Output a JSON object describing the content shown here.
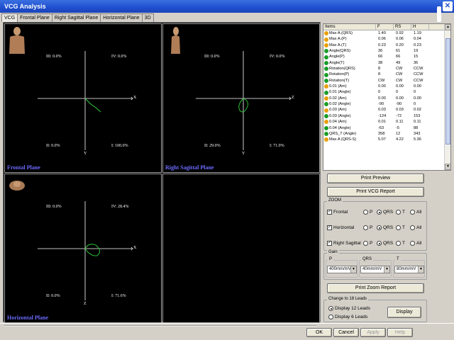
{
  "window": {
    "title": "VCG Analysis"
  },
  "tabs": [
    {
      "label": "VCG",
      "active": true
    },
    {
      "label": "Frontal Plane",
      "active": false
    },
    {
      "label": "Right Sagittal Plane",
      "active": false
    },
    {
      "label": "Horizontal Plane",
      "active": false
    },
    {
      "label": "3D",
      "active": false
    }
  ],
  "planes": {
    "frontal": {
      "label": "Frontal Plane",
      "q_top_left": "III: 0.0%",
      "q_top_right": "IV: 0.0%",
      "q_bottom_left": "II: 0.0%",
      "q_bottom_right": "I: 100.0%",
      "axis_x": "X",
      "axis_y": "Y"
    },
    "sagittal": {
      "label": "Right Sagittal Plane",
      "q_top_left": "III: 0.0%",
      "q_top_right": "IV: 0.0%",
      "q_bottom_left": "II: 29.0%",
      "q_bottom_right": "I: 71.0%",
      "axis_x": "Z",
      "axis_y": "Y"
    },
    "horizontal": {
      "label": "Horizontal Plane",
      "q_top_left": "III: 0.0%",
      "q_top_right": "IV: 28.4%",
      "q_bottom_left": "II: 0.0%",
      "q_bottom_right": "I: 71.6%",
      "axis_x": "X",
      "axis_y": "Z"
    }
  },
  "table": {
    "columns": [
      "Items",
      "F",
      "RS",
      "H"
    ],
    "rows": [
      {
        "icon": "yellow",
        "item": "Max A.(QRS)",
        "f": "1.40",
        "rs": "0.92",
        "h": "1.19"
      },
      {
        "icon": "yellow",
        "item": "Max A.(P)",
        "f": "0.06",
        "rs": "0.06",
        "h": "0.04"
      },
      {
        "icon": "yellow",
        "item": "Max A.(T)",
        "f": "0.23",
        "rs": "0.20",
        "h": "0.23"
      },
      {
        "icon": "green",
        "item": "Angle(QRS)",
        "f": "36",
        "rs": "61",
        "h": "19"
      },
      {
        "icon": "green",
        "item": "Angle(P)",
        "f": "66",
        "rs": "66",
        "h": "15"
      },
      {
        "icon": "green",
        "item": "Angle(T)",
        "f": "38",
        "rs": "49",
        "h": "36"
      },
      {
        "icon": "green",
        "item": "Rotation(QRS)",
        "f": "8",
        "rs": "CW",
        "h": "CCW"
      },
      {
        "icon": "green",
        "item": "Rotation(P)",
        "f": "8",
        "rs": "CW",
        "h": "CCW"
      },
      {
        "icon": "green",
        "item": "Rotation(T)",
        "f": "CW",
        "rs": "CW",
        "h": "CCW"
      },
      {
        "icon": "yellow",
        "item": "0.01 (Am)",
        "f": "0.00",
        "rs": "0.00",
        "h": "0.00"
      },
      {
        "icon": "green",
        "item": "0.01 (Angle)",
        "f": "0",
        "rs": "0",
        "h": "0"
      },
      {
        "icon": "yellow",
        "item": "0.02 (Am)",
        "f": "0.00",
        "rs": "0.00",
        "h": "0.00"
      },
      {
        "icon": "green",
        "item": "0.02 (Angle)",
        "f": "-90",
        "rs": "-90",
        "h": "0"
      },
      {
        "icon": "yellow",
        "item": "0.03 (Am)",
        "f": "0.03",
        "rs": "0.03",
        "h": "0.02"
      },
      {
        "icon": "green",
        "item": "0.03 (Angle)",
        "f": "-124",
        "rs": "-72",
        "h": "153"
      },
      {
        "icon": "yellow",
        "item": "0.04 (Am)",
        "f": "0.01",
        "rs": "0.11",
        "h": "0.11"
      },
      {
        "icon": "green",
        "item": "0.04 (Angle)",
        "f": "-63",
        "rs": "-5",
        "h": "88"
      },
      {
        "icon": "green",
        "item": "QRS_T (Angle)",
        "f": "358",
        "rs": "12",
        "h": "343"
      },
      {
        "icon": "yellow",
        "item": "Max A (QRS-S)",
        "f": "5.07",
        "rs": "4.22",
        "h": "5.36"
      }
    ]
  },
  "buttons": {
    "print_preview": "Print Preview",
    "print_vcg_report": "Print VCG Report",
    "print_zoom_report": "Print Zoom Report",
    "display": "Display",
    "ok": "OK",
    "cancel": "Cancel",
    "apply": "Apply",
    "help": "Help"
  },
  "zoom": {
    "title": "ZOOM",
    "rows": [
      {
        "label": "Frontal",
        "checked": true,
        "selected": "QRS"
      },
      {
        "label": "Horizontal",
        "checked": true,
        "selected": "QRS"
      },
      {
        "label": "Right Sagittal",
        "checked": true,
        "selected": "QRS"
      }
    ],
    "options": [
      "P",
      "QRS",
      "T",
      "All"
    ]
  },
  "gain": {
    "title": "Gain",
    "p_label": "P",
    "qrs_label": "QRS",
    "t_label": "T",
    "p_value": "400mm/mV",
    "qrs_value": "40mm/mV",
    "t_value": "80mm/mV"
  },
  "leads": {
    "title": "Change to 18 Leads",
    "option1": "Display 12 Leads",
    "option2": "Display 6 Leads",
    "selected": "Display 12 Leads"
  },
  "colors": {
    "loop": "#2fd23a",
    "axes": "#ffffff",
    "label": "#6b6bff",
    "titlebar": "#1f4fcf"
  }
}
